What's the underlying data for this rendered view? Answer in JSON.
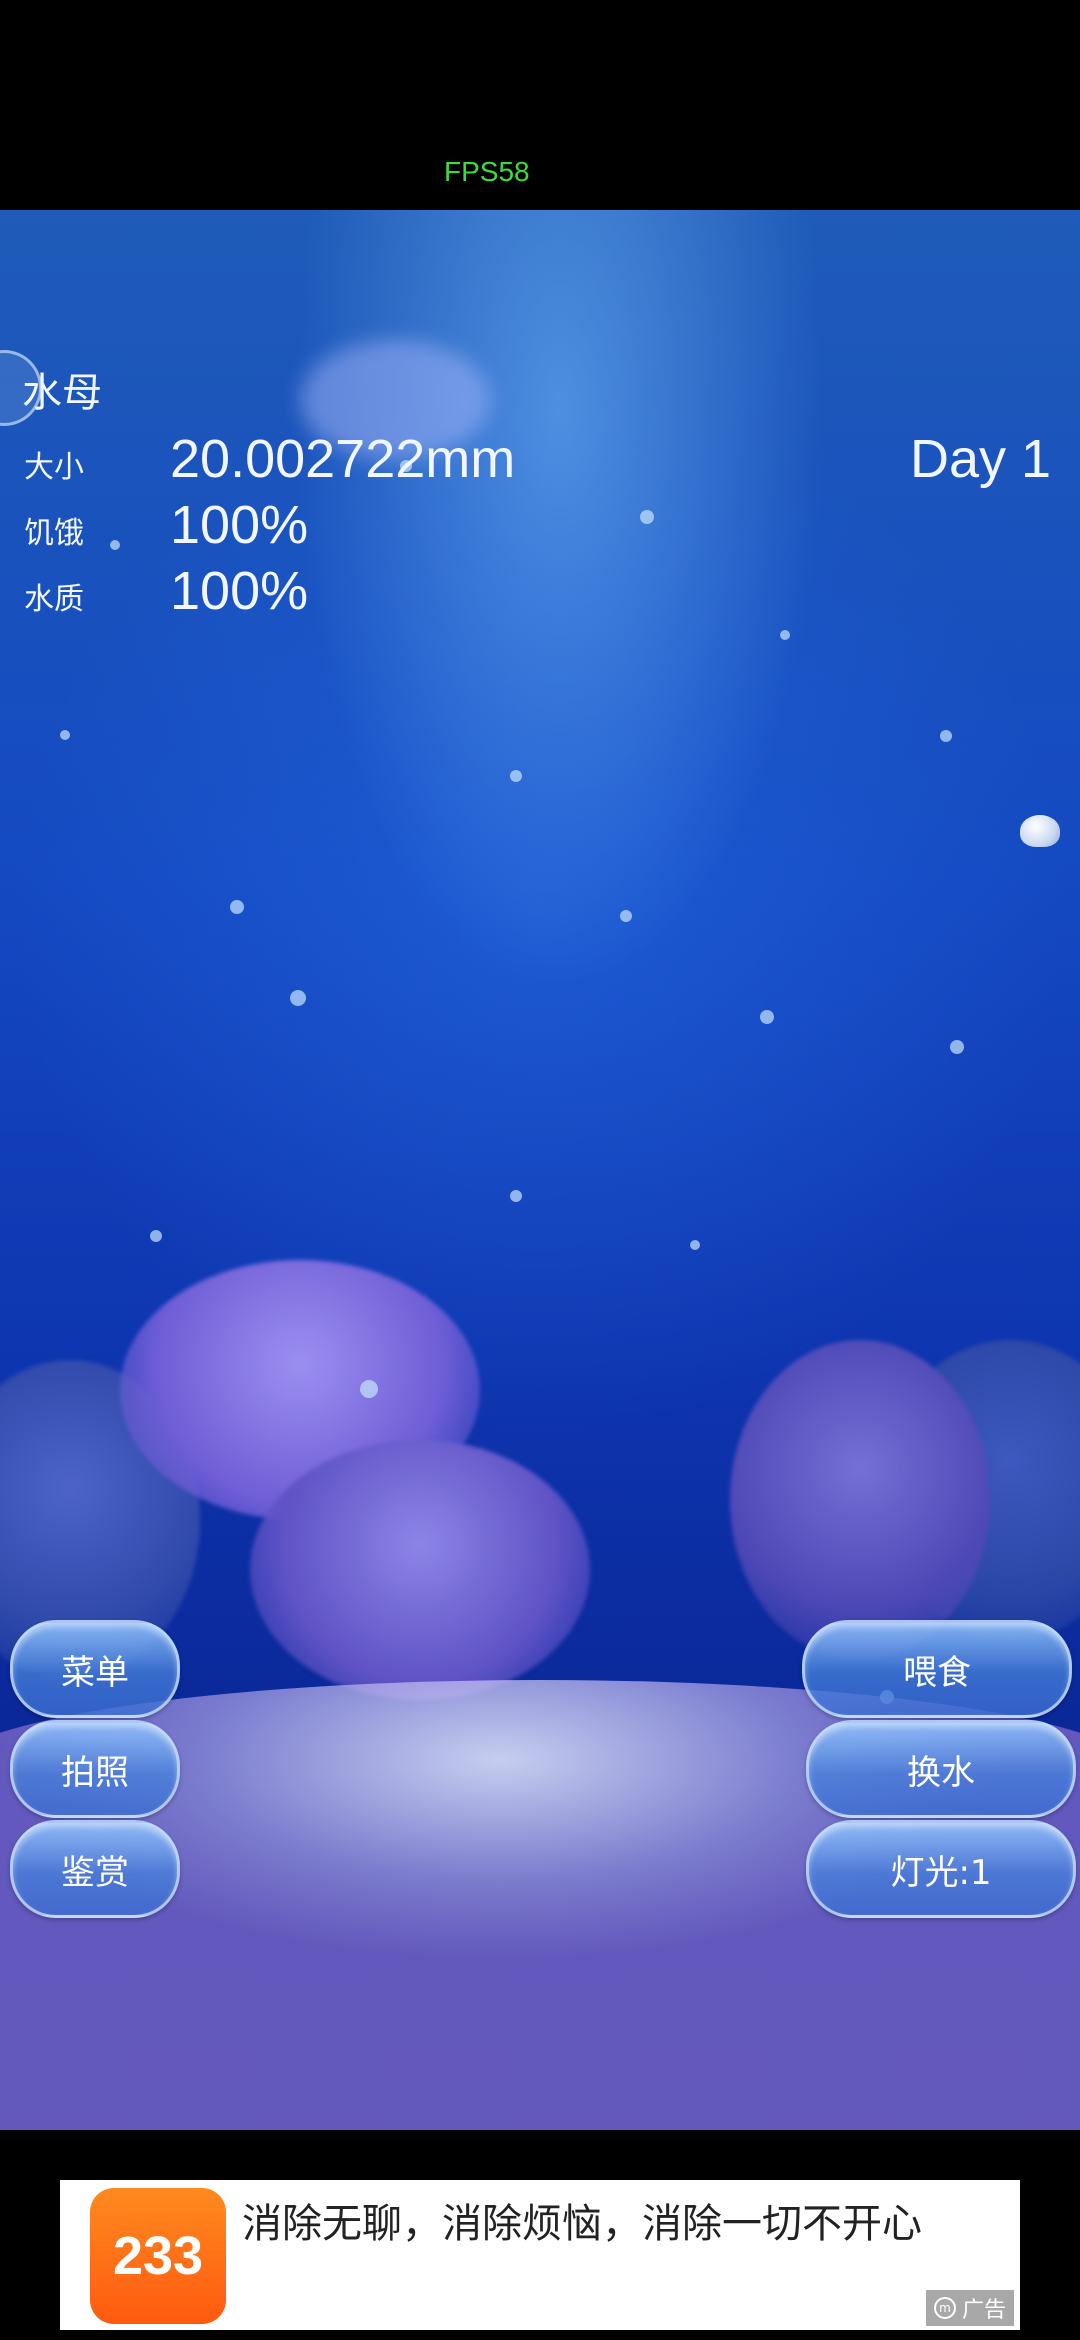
{
  "status": {
    "fps": "FPS58"
  },
  "hud": {
    "title": "水母",
    "size_label": "大小",
    "size_value": "20.002722mm",
    "hunger_label": "饥饿",
    "hunger_value": "100%",
    "water_label": "水质",
    "water_value": "100%",
    "day": "Day 1"
  },
  "left_buttons": [
    "菜单",
    "拍照",
    "鉴赏"
  ],
  "right_buttons": [
    "喂食",
    "换水",
    "灯光:1"
  ],
  "ad": {
    "logo_text": "233",
    "text": "消除无聊，消除烦恼，消除一切不开心",
    "tag": "广告"
  },
  "colors": {
    "fps": "#3ddc3d",
    "ad_logo": "#ff6a14",
    "button": "#5f9be6"
  }
}
